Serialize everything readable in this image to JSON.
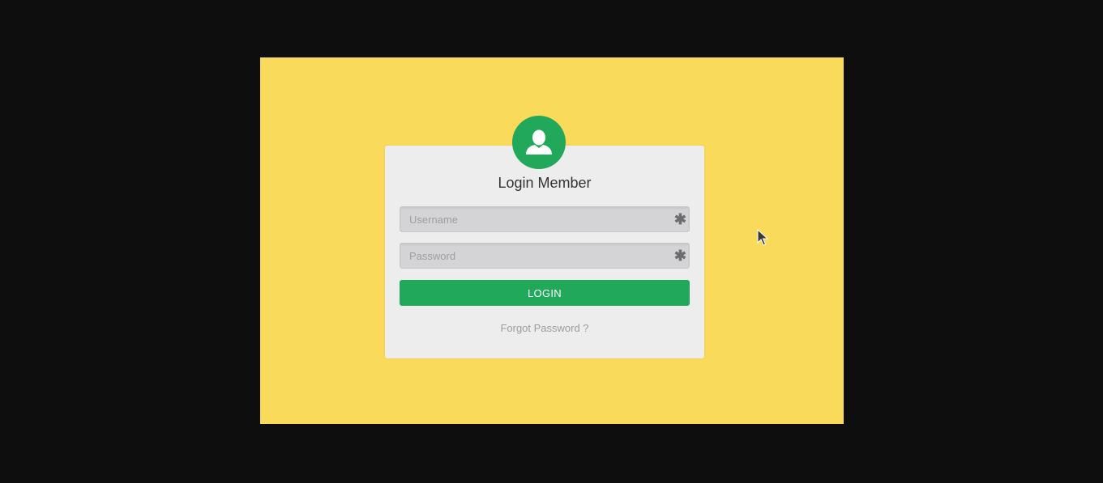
{
  "login": {
    "title": "Login Member",
    "username_placeholder": "Username",
    "password_placeholder": "Password",
    "required_marker": "✱",
    "button_label": "LOGIN",
    "forgot_label": "Forgot Password ?"
  },
  "icons": {
    "avatar": "user-icon",
    "cursor": "mouse-pointer-icon"
  },
  "colors": {
    "background": "#0e0e0e",
    "stage": "#f9da5a",
    "card": "#ededed",
    "accent": "#22a85a",
    "input": "#d4d3d5"
  }
}
